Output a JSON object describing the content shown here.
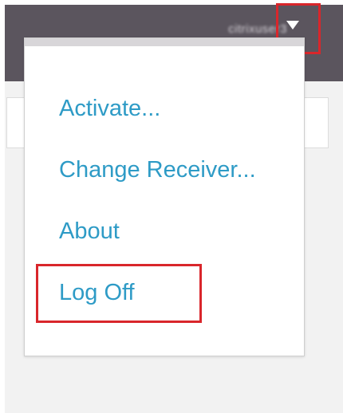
{
  "header": {
    "username": "citrixuser3",
    "menu_caret_icon": "caret-down-icon"
  },
  "dropdown": {
    "items": [
      {
        "label": "Activate..."
      },
      {
        "label": "Change Receiver..."
      },
      {
        "label": "About"
      },
      {
        "label": "Log Off"
      }
    ]
  },
  "colors": {
    "header_bg": "#5b555e",
    "menu_text": "#2e9bc6",
    "highlight_border": "#d9262b",
    "page_bg": "#f2f2f2"
  }
}
